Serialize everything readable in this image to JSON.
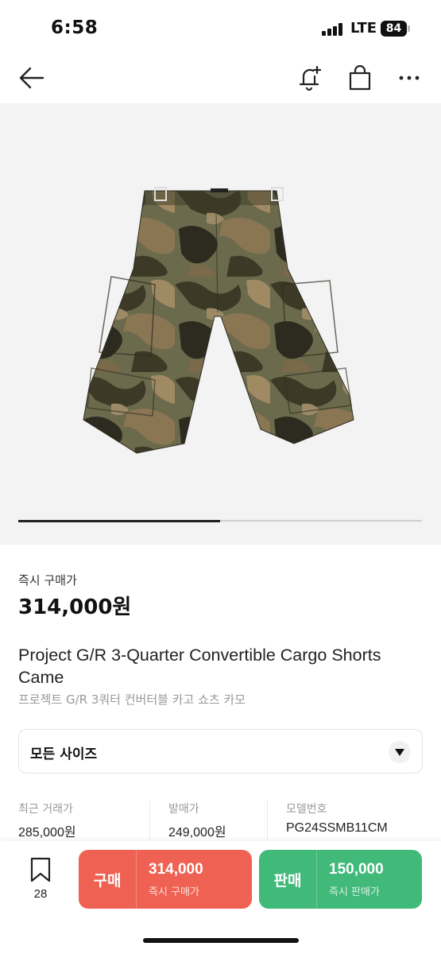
{
  "status": {
    "time": "6:58",
    "network": "LTE",
    "battery": "84"
  },
  "header": {
    "back_icon": "arrow-left-icon",
    "alert_icon": "bell-plus-icon",
    "bag_icon": "shopping-bag-icon",
    "more_icon": "more-dots-icon"
  },
  "gallery": {
    "progress": 0.5
  },
  "price": {
    "label": "즉시 구매가",
    "value": "314,000원"
  },
  "product": {
    "title_en": "Project G/R 3-Quarter Convertible Cargo Shorts Came",
    "title_ko": "프로젝트 G/R 3쿼터 컨버터블 카고 쇼츠 카모"
  },
  "size_select": {
    "label": "모든 사이즈",
    "icon": "triangle-down-icon"
  },
  "info": [
    {
      "label": "최근 거래가",
      "value": "285,000원"
    },
    {
      "label": "발매가",
      "value": "249,000원"
    },
    {
      "label": "모델번호",
      "value": "PG24SSMB11CM"
    }
  ],
  "bottom": {
    "wish_count": "28",
    "buy": {
      "label": "구매",
      "amount": "314,000",
      "sub": "즉시 구매가",
      "color": "#ef6253"
    },
    "sell": {
      "label": "판매",
      "amount": "150,000",
      "sub": "즉시 판매가",
      "color": "#41b979"
    }
  }
}
